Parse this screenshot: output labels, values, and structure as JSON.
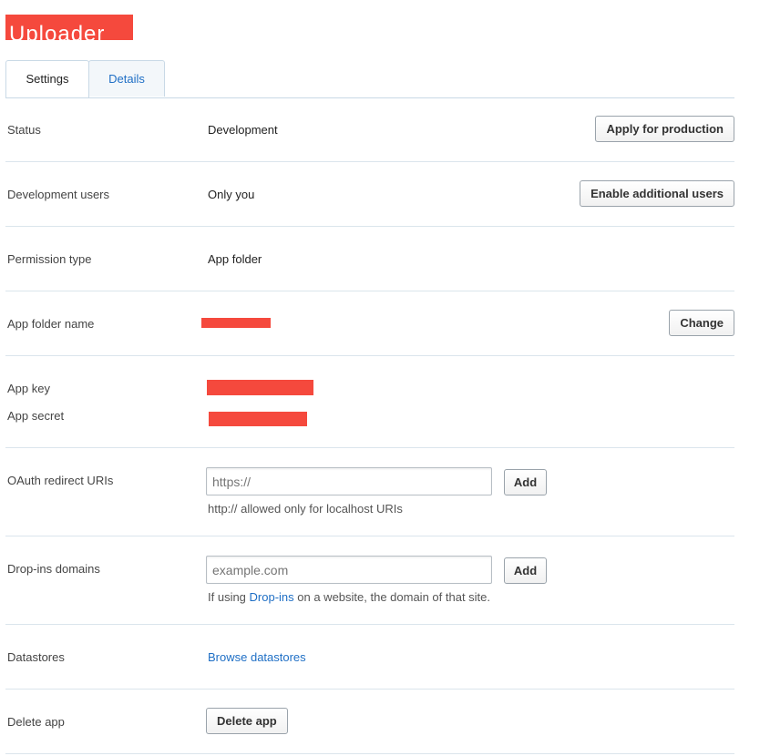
{
  "header": {
    "app_name_redacted": "Uploader"
  },
  "tabs": [
    {
      "label": "Settings",
      "active": true
    },
    {
      "label": "Details",
      "active": false
    }
  ],
  "rows": {
    "status": {
      "label": "Status",
      "value": "Development",
      "button": "Apply for production"
    },
    "dev_users": {
      "label": "Development users",
      "value": "Only you",
      "button": "Enable additional users"
    },
    "permission": {
      "label": "Permission type",
      "value": "App folder"
    },
    "app_folder": {
      "label": "App folder name",
      "button": "Change"
    },
    "keys": {
      "app_key_label": "App key",
      "app_secret_label": "App secret"
    },
    "oauth": {
      "label": "OAuth redirect URIs",
      "placeholder": "https://",
      "add_label": "Add",
      "hint": "http:// allowed only for localhost URIs"
    },
    "dropins": {
      "label": "Drop-ins domains",
      "placeholder": "example.com",
      "add_label": "Add",
      "hint_prefix": "If using ",
      "hint_link": "Drop-ins",
      "hint_suffix": " on a website, the domain of that site."
    },
    "datastores": {
      "label": "Datastores",
      "link": "Browse datastores"
    },
    "delete": {
      "label": "Delete app",
      "button": "Delete app"
    }
  },
  "colors": {
    "link": "#1f6fc5",
    "redaction": "#f5493d",
    "divider": "#dbe5ec"
  }
}
